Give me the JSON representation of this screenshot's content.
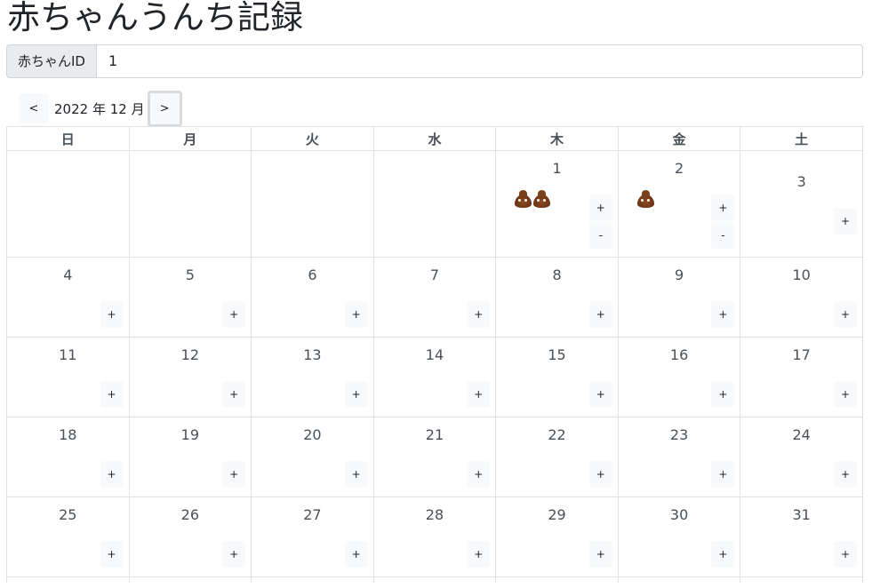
{
  "title": "赤ちゃんうんち記録",
  "baby_id": {
    "label": "赤ちゃんID",
    "value": "1"
  },
  "nav": {
    "prev_label": "<",
    "next_label": ">",
    "month_label": "2022 年 12 月"
  },
  "weekdays": [
    "日",
    "月",
    "火",
    "水",
    "木",
    "金",
    "土"
  ],
  "add_label": "+",
  "remove_label": "-",
  "weeks": [
    [
      null,
      null,
      null,
      null,
      {
        "day": "1",
        "poops": 2
      },
      {
        "day": "2",
        "poops": 1
      },
      {
        "day": "3",
        "poops": 0
      }
    ],
    [
      {
        "day": "4",
        "poops": 0
      },
      {
        "day": "5",
        "poops": 0
      },
      {
        "day": "6",
        "poops": 0
      },
      {
        "day": "7",
        "poops": 0
      },
      {
        "day": "8",
        "poops": 0
      },
      {
        "day": "9",
        "poops": 0
      },
      {
        "day": "10",
        "poops": 0
      }
    ],
    [
      {
        "day": "11",
        "poops": 0
      },
      {
        "day": "12",
        "poops": 0
      },
      {
        "day": "13",
        "poops": 0
      },
      {
        "day": "14",
        "poops": 0
      },
      {
        "day": "15",
        "poops": 0
      },
      {
        "day": "16",
        "poops": 0
      },
      {
        "day": "17",
        "poops": 0
      }
    ],
    [
      {
        "day": "18",
        "poops": 0
      },
      {
        "day": "19",
        "poops": 0
      },
      {
        "day": "20",
        "poops": 0
      },
      {
        "day": "21",
        "poops": 0
      },
      {
        "day": "22",
        "poops": 0
      },
      {
        "day": "23",
        "poops": 0
      },
      {
        "day": "24",
        "poops": 0
      }
    ],
    [
      {
        "day": "25",
        "poops": 0
      },
      {
        "day": "26",
        "poops": 0
      },
      {
        "day": "27",
        "poops": 0
      },
      {
        "day": "28",
        "poops": 0
      },
      {
        "day": "29",
        "poops": 0
      },
      {
        "day": "30",
        "poops": 0
      },
      {
        "day": "31",
        "poops": 0
      }
    ],
    [
      null,
      null,
      null,
      null,
      null,
      null,
      null
    ]
  ],
  "colors": {
    "sunday": "#dc3545",
    "saturday": "#0d6efd",
    "border": "#dee2e6",
    "button_bg": "#f8f9fa"
  }
}
